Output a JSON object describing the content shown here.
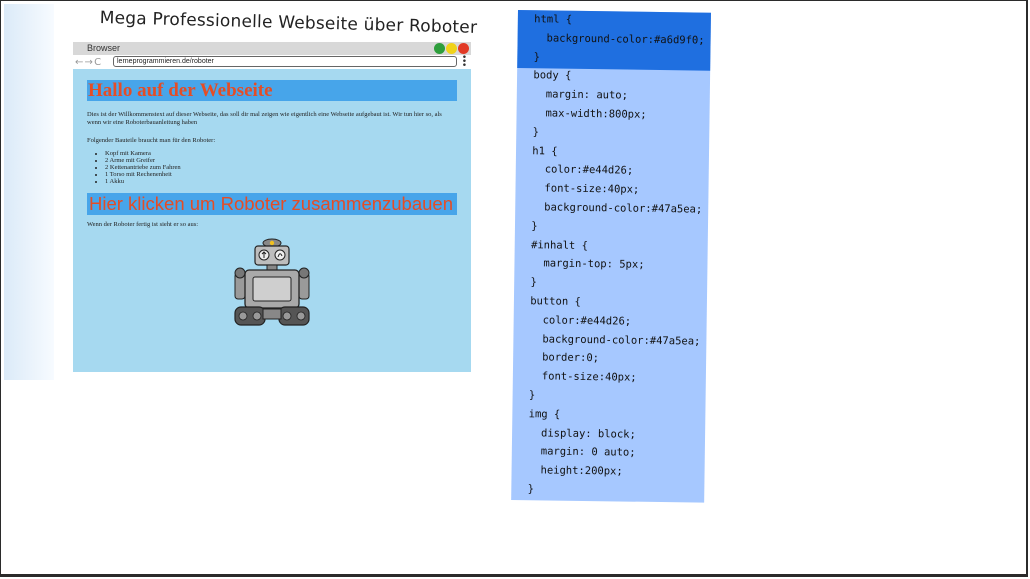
{
  "slide": {
    "title": "Mega Professionelle Webseite über Roboter"
  },
  "browser": {
    "label": "Browser",
    "nav": "← → C",
    "url": "lerneprogrammieren.de/roboter",
    "menu_icon": "kebab-menu-icon",
    "controls": [
      "green-dot",
      "yellow-dot",
      "red-dot"
    ]
  },
  "page": {
    "heading": "Hallo auf der Webseite",
    "intro": "Dies ist der Willkommenstext auf dieser Webseite, das soll dir mal zeigen wie eigentlich eine Webseite aufgebaut ist. Wir tun hier so, als wenn wir eine Roboterbauanleitung haben",
    "parts_intro": "Folgender Bauteile braucht man für den Roboter:",
    "parts": [
      "Kopf mit Kamera",
      "2 Arme mit Greifer",
      "2 Kettenantriebe zum Fahren",
      "1 Torso mit Rechenenheit",
      "1 Akku"
    ],
    "button_label": "Hier klicken um Roboter zusammenzubauen",
    "finished_text": "Wenn der Roboter fertig ist sieht er so aus:",
    "image_icon": "robot-image"
  },
  "code": {
    "lines": [
      " html {",
      "   background-color:#a6d9f0;",
      " }",
      " body {",
      "   margin: auto;",
      "   max-width:800px;",
      " }",
      " h1 {",
      "   color:#e44d26;",
      "   font-size:40px;",
      "   background-color:#47a5ea;",
      " }",
      " #inhalt {",
      "   margin-top: 5px;",
      " }",
      " button {",
      "   color:#e44d26;",
      "   background-color:#47a5ea;",
      "   border:0;",
      "   font-size:40px;",
      " }",
      " img {",
      "   display: block;",
      "   margin: 0 auto;",
      "   height:200px;",
      " }"
    ]
  },
  "colors": {
    "page_bg": "#a6d9f0",
    "heading": "#e44d26",
    "heading_bg": "#47a5ea",
    "code_bg": "#a6c8ff",
    "code_highlight": "#1f6fe0"
  }
}
